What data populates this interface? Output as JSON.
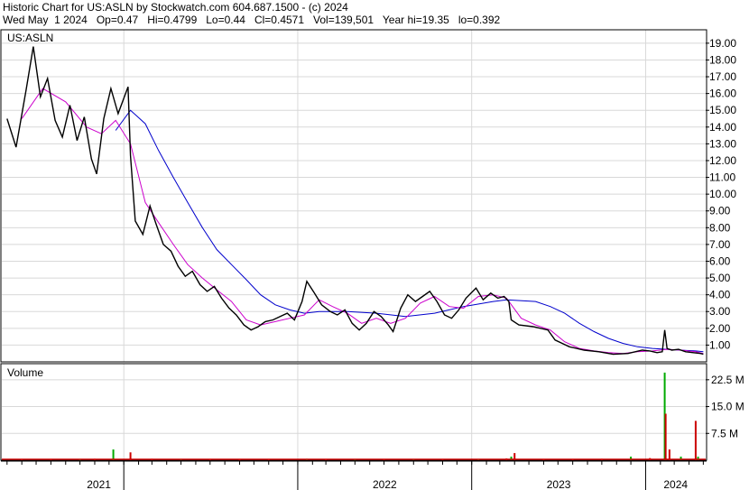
{
  "header": {
    "line1": "Historic Chart for US:ASLN by Stockwatch.com 604.687.1500 - (c) 2024",
    "line2": "Wed May  1 2024   Op=0.47   Hi=0.4799   Lo=0.44   Cl=0.4571   Vol=139,501   Year hi=19.35   lo=0.392"
  },
  "price_panel": {
    "label": "US:ASLN"
  },
  "volume_panel": {
    "label": "Volume"
  },
  "chart_data": [
    {
      "type": "line",
      "title": "US:ASLN",
      "x_unit": "date",
      "year_labels": [
        "2021",
        "2022",
        "2023",
        "2024"
      ],
      "ylim": [
        0,
        19.8
      ],
      "y_ticks": [
        "1.00",
        "2.00",
        "3.00",
        "4.00",
        "5.00",
        "6.00",
        "7.00",
        "8.00",
        "9.00",
        "10.00",
        "11.00",
        "12.00",
        "13.00",
        "14.00",
        "15.00",
        "16.00",
        "17.00",
        "18.00",
        "19.00"
      ],
      "grid": true,
      "series": [
        {
          "role": "close",
          "color": "#000000",
          "points": [
            [
              "2020-05-01",
              14.5
            ],
            [
              "2020-05-20",
              12.8
            ],
            [
              "2020-06-10",
              16.2
            ],
            [
              "2020-06-25",
              18.8
            ],
            [
              "2020-07-10",
              15.8
            ],
            [
              "2020-07-25",
              16.9
            ],
            [
              "2020-08-10",
              14.4
            ],
            [
              "2020-08-25",
              13.4
            ],
            [
              "2020-09-10",
              15.3
            ],
            [
              "2020-09-25",
              13.2
            ],
            [
              "2020-10-10",
              14.6
            ],
            [
              "2020-10-25",
              12.1
            ],
            [
              "2020-11-05",
              11.2
            ],
            [
              "2020-11-20",
              14.5
            ],
            [
              "2020-12-05",
              16.3
            ],
            [
              "2020-12-20",
              14.8
            ],
            [
              "2021-01-10",
              16.4
            ],
            [
              "2021-01-15",
              12.3
            ],
            [
              "2021-01-25",
              8.4
            ],
            [
              "2021-02-10",
              7.6
            ],
            [
              "2021-02-25",
              9.3
            ],
            [
              "2021-03-10",
              8.2
            ],
            [
              "2021-03-25",
              7.0
            ],
            [
              "2021-04-10",
              6.6
            ],
            [
              "2021-04-25",
              5.7
            ],
            [
              "2021-05-10",
              5.1
            ],
            [
              "2021-05-25",
              5.4
            ],
            [
              "2021-06-10",
              4.6
            ],
            [
              "2021-06-25",
              4.2
            ],
            [
              "2021-07-10",
              4.5
            ],
            [
              "2021-07-25",
              3.8
            ],
            [
              "2021-08-10",
              3.2
            ],
            [
              "2021-08-25",
              2.8
            ],
            [
              "2021-09-10",
              2.2
            ],
            [
              "2021-09-25",
              1.9
            ],
            [
              "2021-10-10",
              2.1
            ],
            [
              "2021-10-25",
              2.4
            ],
            [
              "2021-11-10",
              2.5
            ],
            [
              "2021-11-25",
              2.7
            ],
            [
              "2021-12-10",
              2.9
            ],
            [
              "2021-12-25",
              2.5
            ],
            [
              "2022-01-10",
              3.6
            ],
            [
              "2022-01-20",
              4.8
            ],
            [
              "2022-02-05",
              4.1
            ],
            [
              "2022-02-20",
              3.4
            ],
            [
              "2022-03-10",
              3.0
            ],
            [
              "2022-03-25",
              2.8
            ],
            [
              "2022-04-10",
              3.1
            ],
            [
              "2022-04-25",
              2.3
            ],
            [
              "2022-05-10",
              1.9
            ],
            [
              "2022-05-25",
              2.3
            ],
            [
              "2022-06-10",
              3.0
            ],
            [
              "2022-06-25",
              2.7
            ],
            [
              "2022-07-10",
              2.2
            ],
            [
              "2022-07-20",
              1.8
            ],
            [
              "2022-08-05",
              3.2
            ],
            [
              "2022-08-20",
              4.0
            ],
            [
              "2022-09-05",
              3.6
            ],
            [
              "2022-09-20",
              3.9
            ],
            [
              "2022-10-05",
              4.2
            ],
            [
              "2022-10-20",
              3.6
            ],
            [
              "2022-11-05",
              2.8
            ],
            [
              "2022-11-20",
              2.6
            ],
            [
              "2022-12-05",
              3.1
            ],
            [
              "2022-12-20",
              3.8
            ],
            [
              "2023-01-10",
              4.4
            ],
            [
              "2023-01-25",
              3.7
            ],
            [
              "2023-02-10",
              4.1
            ],
            [
              "2023-02-25",
              3.8
            ],
            [
              "2023-03-10",
              3.9
            ],
            [
              "2023-03-20",
              3.6
            ],
            [
              "2023-03-25",
              2.5
            ],
            [
              "2023-04-10",
              2.2
            ],
            [
              "2023-05-10",
              2.1
            ],
            [
              "2023-06-10",
              1.9
            ],
            [
              "2023-06-25",
              1.3
            ],
            [
              "2023-07-25",
              0.9
            ],
            [
              "2023-08-25",
              0.7
            ],
            [
              "2023-09-25",
              0.6
            ],
            [
              "2023-10-25",
              0.45
            ],
            [
              "2023-11-25",
              0.5
            ],
            [
              "2023-12-25",
              0.7
            ],
            [
              "2024-01-10",
              0.65
            ],
            [
              "2024-01-25",
              0.55
            ],
            [
              "2024-02-05",
              0.6
            ],
            [
              "2024-02-10",
              1.9
            ],
            [
              "2024-02-15",
              0.8
            ],
            [
              "2024-02-25",
              0.7
            ],
            [
              "2024-03-10",
              0.75
            ],
            [
              "2024-03-25",
              0.6
            ],
            [
              "2024-04-10",
              0.55
            ],
            [
              "2024-04-25",
              0.5
            ],
            [
              "2024-05-01",
              0.4571
            ]
          ]
        },
        {
          "role": "short moving average",
          "color": "#cc00cc",
          "points": [
            [
              "2020-06-01",
              14.5
            ],
            [
              "2020-07-15",
              16.3
            ],
            [
              "2020-09-01",
              15.5
            ],
            [
              "2020-10-15",
              14.0
            ],
            [
              "2020-11-15",
              13.6
            ],
            [
              "2020-12-15",
              14.4
            ],
            [
              "2021-01-15",
              13.0
            ],
            [
              "2021-02-15",
              9.5
            ],
            [
              "2021-03-15",
              8.3
            ],
            [
              "2021-04-15",
              7.0
            ],
            [
              "2021-05-15",
              5.8
            ],
            [
              "2021-06-15",
              5.0
            ],
            [
              "2021-07-15",
              4.3
            ],
            [
              "2021-08-15",
              3.6
            ],
            [
              "2021-09-15",
              2.5
            ],
            [
              "2021-10-15",
              2.2
            ],
            [
              "2021-11-15",
              2.4
            ],
            [
              "2021-12-15",
              2.6
            ],
            [
              "2022-01-15",
              2.8
            ],
            [
              "2022-02-15",
              3.7
            ],
            [
              "2022-03-15",
              3.3
            ],
            [
              "2022-04-15",
              2.9
            ],
            [
              "2022-05-15",
              2.3
            ],
            [
              "2022-06-15",
              2.6
            ],
            [
              "2022-07-15",
              2.3
            ],
            [
              "2022-08-15",
              2.6
            ],
            [
              "2022-09-15",
              3.5
            ],
            [
              "2022-10-15",
              3.9
            ],
            [
              "2022-11-15",
              3.3
            ],
            [
              "2022-12-15",
              3.2
            ],
            [
              "2023-01-15",
              3.9
            ],
            [
              "2023-02-15",
              4.0
            ],
            [
              "2023-03-15",
              3.8
            ],
            [
              "2023-04-15",
              2.6
            ],
            [
              "2023-05-15",
              2.2
            ],
            [
              "2023-06-15",
              1.9
            ],
            [
              "2023-07-15",
              1.2
            ],
            [
              "2023-08-15",
              0.8
            ],
            [
              "2023-09-15",
              0.65
            ],
            [
              "2023-10-15",
              0.55
            ],
            [
              "2023-11-15",
              0.5
            ],
            [
              "2023-12-15",
              0.6
            ],
            [
              "2024-01-15",
              0.65
            ],
            [
              "2024-02-15",
              0.75
            ],
            [
              "2024-03-15",
              0.7
            ],
            [
              "2024-04-15",
              0.6
            ],
            [
              "2024-05-01",
              0.5
            ]
          ]
        },
        {
          "role": "long moving average",
          "color": "#0000cc",
          "points": [
            [
              "2020-12-15",
              13.8
            ],
            [
              "2021-01-15",
              15.0
            ],
            [
              "2021-02-15",
              14.2
            ],
            [
              "2021-03-15",
              12.6
            ],
            [
              "2021-04-15",
              11.0
            ],
            [
              "2021-05-15",
              9.5
            ],
            [
              "2021-06-15",
              8.0
            ],
            [
              "2021-07-15",
              6.7
            ],
            [
              "2021-08-15",
              5.8
            ],
            [
              "2021-09-15",
              4.9
            ],
            [
              "2021-10-15",
              4.0
            ],
            [
              "2021-11-15",
              3.4
            ],
            [
              "2021-12-15",
              3.1
            ],
            [
              "2022-01-15",
              2.9
            ],
            [
              "2022-02-15",
              3.0
            ],
            [
              "2022-04-15",
              3.0
            ],
            [
              "2022-06-15",
              2.9
            ],
            [
              "2022-08-15",
              2.7
            ],
            [
              "2022-10-15",
              2.9
            ],
            [
              "2022-12-15",
              3.3
            ],
            [
              "2023-02-15",
              3.6
            ],
            [
              "2023-03-15",
              3.7
            ],
            [
              "2023-05-15",
              3.6
            ],
            [
              "2023-06-15",
              3.3
            ],
            [
              "2023-07-15",
              2.9
            ],
            [
              "2023-08-15",
              2.3
            ],
            [
              "2023-09-15",
              1.8
            ],
            [
              "2023-10-15",
              1.4
            ],
            [
              "2023-11-15",
              1.1
            ],
            [
              "2023-12-15",
              0.9
            ],
            [
              "2024-01-15",
              0.8
            ],
            [
              "2024-02-15",
              0.75
            ],
            [
              "2024-03-15",
              0.7
            ],
            [
              "2024-04-15",
              0.65
            ],
            [
              "2024-05-01",
              0.6
            ]
          ]
        }
      ]
    },
    {
      "type": "bar",
      "title": "Volume",
      "ylim": [
        0,
        27000000
      ],
      "y_ticks": [
        "7.5 M",
        "15.0 M",
        "22.5 M"
      ],
      "grid": true,
      "up_color": "#00aa00",
      "down_color": "#cc0000",
      "bars": [
        [
          "2020-06-01",
          300000,
          "down"
        ],
        [
          "2020-08-01",
          250000,
          "down"
        ],
        [
          "2020-10-01",
          220000,
          "up"
        ],
        [
          "2020-11-01",
          400000,
          "down"
        ],
        [
          "2020-12-10",
          3000000,
          "up"
        ],
        [
          "2021-01-15",
          2200000,
          "down"
        ],
        [
          "2021-03-01",
          400000,
          "down"
        ],
        [
          "2021-05-01",
          300000,
          "up"
        ],
        [
          "2021-07-01",
          250000,
          "down"
        ],
        [
          "2021-09-01",
          220000,
          "down"
        ],
        [
          "2021-11-01",
          350000,
          "down"
        ],
        [
          "2022-01-20",
          400000,
          "up"
        ],
        [
          "2022-03-01",
          250000,
          "down"
        ],
        [
          "2022-05-01",
          220000,
          "up"
        ],
        [
          "2022-07-01",
          300000,
          "down"
        ],
        [
          "2022-09-01",
          300000,
          "up"
        ],
        [
          "2022-11-01",
          250000,
          "down"
        ],
        [
          "2023-01-15",
          300000,
          "up"
        ],
        [
          "2023-03-15",
          500000,
          "down"
        ],
        [
          "2023-03-25",
          1000000,
          "up"
        ],
        [
          "2023-04-01",
          2000000,
          "down"
        ],
        [
          "2023-06-01",
          300000,
          "down"
        ],
        [
          "2023-08-01",
          300000,
          "down"
        ],
        [
          "2023-10-01",
          400000,
          "down"
        ],
        [
          "2023-12-01",
          1000000,
          "up"
        ],
        [
          "2024-01-10",
          600000,
          "down"
        ],
        [
          "2024-02-10",
          24500000,
          "up"
        ],
        [
          "2024-02-12",
          13000000,
          "down"
        ],
        [
          "2024-02-20",
          3000000,
          "down"
        ],
        [
          "2024-03-15",
          1000000,
          "up"
        ],
        [
          "2024-04-15",
          11000000,
          "down"
        ],
        [
          "2024-04-20",
          1000000,
          "up"
        ]
      ]
    }
  ]
}
